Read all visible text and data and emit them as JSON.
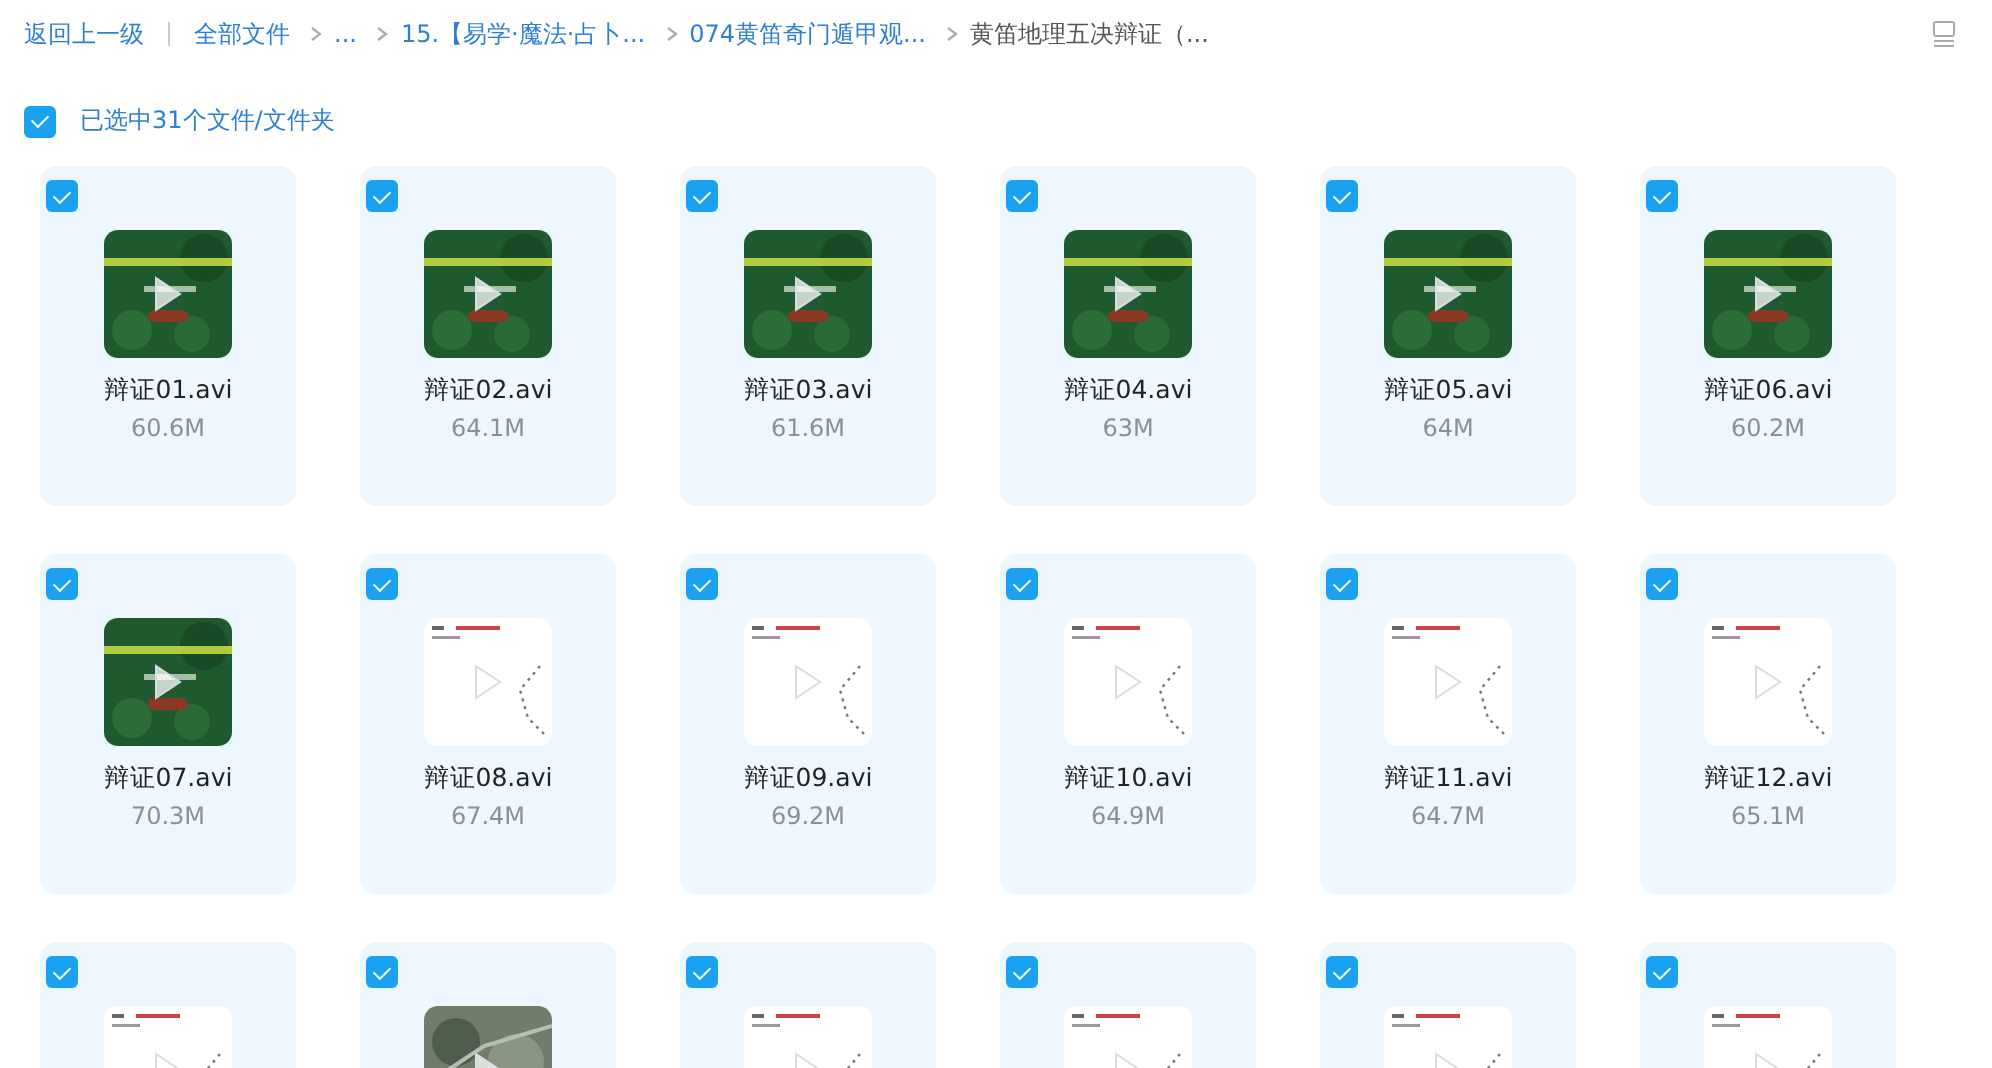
{
  "breadcrumb": {
    "back": "返回上一级",
    "items": [
      {
        "label": "全部文件",
        "current": false
      },
      {
        "label": "...",
        "current": false
      },
      {
        "label": "15.【易学·魔法·占卜...",
        "current": false
      },
      {
        "label": "074黄笛奇门遁甲观...",
        "current": false
      },
      {
        "label": "黄笛地理五决辩证（...",
        "current": true
      }
    ]
  },
  "selection": {
    "checked": true,
    "label": "已选中31个文件/文件夹"
  },
  "files": [
    {
      "name": "辩证01.avi",
      "size": "60.6M",
      "selected": true
    },
    {
      "name": "辩证02.avi",
      "size": "64.1M",
      "selected": true
    },
    {
      "name": "辩证03.avi",
      "size": "61.6M",
      "selected": true
    },
    {
      "name": "辩证04.avi",
      "size": "63M",
      "selected": true
    },
    {
      "name": "辩证05.avi",
      "size": "64M",
      "selected": true
    },
    {
      "name": "辩证06.avi",
      "size": "60.2M",
      "selected": true
    },
    {
      "name": "辩证07.avi",
      "size": "70.3M",
      "selected": true
    },
    {
      "name": "辩证08.avi",
      "size": "67.4M",
      "selected": true
    },
    {
      "name": "辩证09.avi",
      "size": "69.2M",
      "selected": true
    },
    {
      "name": "辩证10.avi",
      "size": "64.9M",
      "selected": true
    },
    {
      "name": "辩证11.avi",
      "size": "64.7M",
      "selected": true
    },
    {
      "name": "辩证12.avi",
      "size": "65.1M",
      "selected": true
    },
    {
      "selected": true
    },
    {
      "selected": true
    },
    {
      "selected": true
    },
    {
      "selected": true
    },
    {
      "selected": true
    },
    {
      "selected": true
    }
  ]
}
